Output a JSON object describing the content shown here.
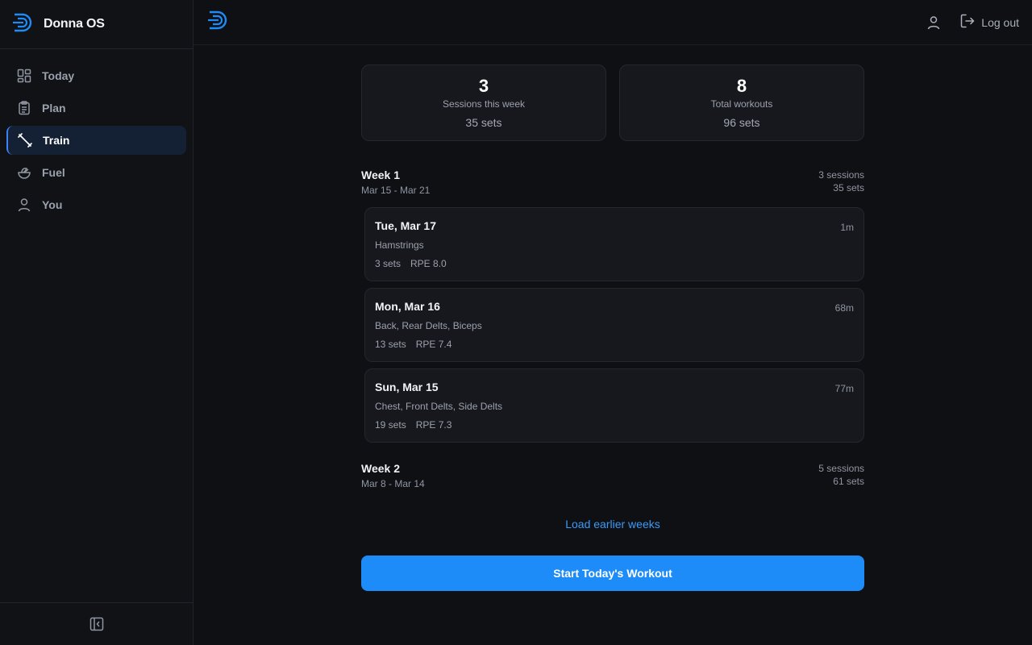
{
  "brand": {
    "name": "Donna OS"
  },
  "sidebar": {
    "items": [
      {
        "label": "Today",
        "icon": "dashboard-grid-icon",
        "active": false
      },
      {
        "label": "Plan",
        "icon": "clipboard-icon",
        "active": false
      },
      {
        "label": "Train",
        "icon": "dumbbell-icon",
        "active": true
      },
      {
        "label": "Fuel",
        "icon": "salad-bowl-icon",
        "active": false
      },
      {
        "label": "You",
        "icon": "user-icon",
        "active": false
      }
    ]
  },
  "topbar": {
    "logout_label": "Log out"
  },
  "stats": [
    {
      "value": "3",
      "label": "Sessions this week",
      "sub": "35 sets"
    },
    {
      "value": "8",
      "label": "Total workouts",
      "sub": "96 sets"
    }
  ],
  "weeks": [
    {
      "title": "Week 1",
      "range": "Mar 15 - Mar 21",
      "sessions_count": "3 sessions",
      "sets_count": "35 sets",
      "sessions": [
        {
          "date": "Tue, Mar 17",
          "duration": "1m",
          "muscles": "Hamstrings",
          "sets": "3 sets",
          "rpe": "RPE 8.0"
        },
        {
          "date": "Mon, Mar 16",
          "duration": "68m",
          "muscles": "Back, Rear Delts, Biceps",
          "sets": "13 sets",
          "rpe": "RPE 7.4"
        },
        {
          "date": "Sun, Mar 15",
          "duration": "77m",
          "muscles": "Chest, Front Delts, Side Delts",
          "sets": "19 sets",
          "rpe": "RPE 7.3"
        }
      ]
    },
    {
      "title": "Week 2",
      "range": "Mar 8 - Mar 14",
      "sessions_count": "5 sessions",
      "sets_count": "61 sets"
    }
  ],
  "load_more_label": "Load earlier weeks",
  "start_button_label": "Start Today's Workout",
  "colors": {
    "accent": "#1d8bf8",
    "background": "#0f1014",
    "card": "#17181d",
    "active_nav": "#142033"
  }
}
